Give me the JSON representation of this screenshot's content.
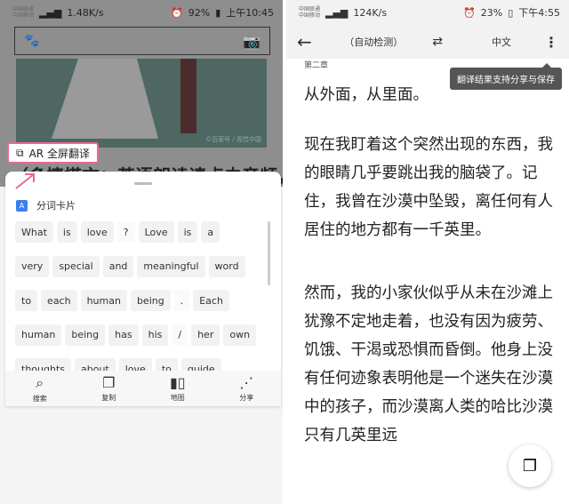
{
  "left": {
    "status": {
      "carrier1": "中国联通",
      "carrier2": "中国移动",
      "speed": "1.48K/s",
      "battery": "92%",
      "time": "上午10:45"
    },
    "image_credit": "©百家号 / 视觉中国",
    "headline": "（多情搭亦：英语朗读请点击音频，本文中",
    "ar_button": "AR 全屏翻译",
    "card_title": "分词卡片",
    "word_rows": [
      [
        "What",
        "is",
        "love",
        "?",
        "Love",
        "is",
        "a"
      ],
      [
        "very",
        "special",
        "and",
        "meaningful",
        "word"
      ],
      [
        "to",
        "each",
        "human",
        "being",
        ".",
        "Each"
      ],
      [
        "human",
        "being",
        "has",
        "his",
        "/",
        "her",
        "own"
      ],
      [
        "thoughts",
        "about",
        "love",
        "to",
        "guide"
      ]
    ],
    "bottom_bar": [
      {
        "icon": "search-icon",
        "label": "搜索"
      },
      {
        "icon": "copy-icon",
        "label": "复制"
      },
      {
        "icon": "map-icon",
        "label": "地图"
      },
      {
        "icon": "share-icon",
        "label": "分享"
      }
    ],
    "accent": "#e8679a"
  },
  "right": {
    "status": {
      "carrier1": "中国联通",
      "carrier2": "中国移动",
      "speed": "124K/s",
      "battery": "23%",
      "time": "下午4:55"
    },
    "source_lang": "（自动检测）",
    "target_lang": "中文",
    "chapter": "第二章",
    "tooltip": "翻译结果支持分享与保存",
    "paragraphs": [
      "从外面，从里面。",
      "现在我盯着这个突然出现的东西，我的眼睛几乎要跳出我的脑袋了。记住，我曾在沙漠中坠毁，离任何有人居住的地方都有一千英里。",
      "然而，我的小家伙似乎从未在沙滩上犹豫不定地走着，也没有因为疲劳、饥饿、干渴或恐惧而昏倒。他身上没有任何迹象表明他是一个迷失在沙漠中的孩子，而沙漠离人类的哈比沙漠只有几英里远"
    ]
  }
}
